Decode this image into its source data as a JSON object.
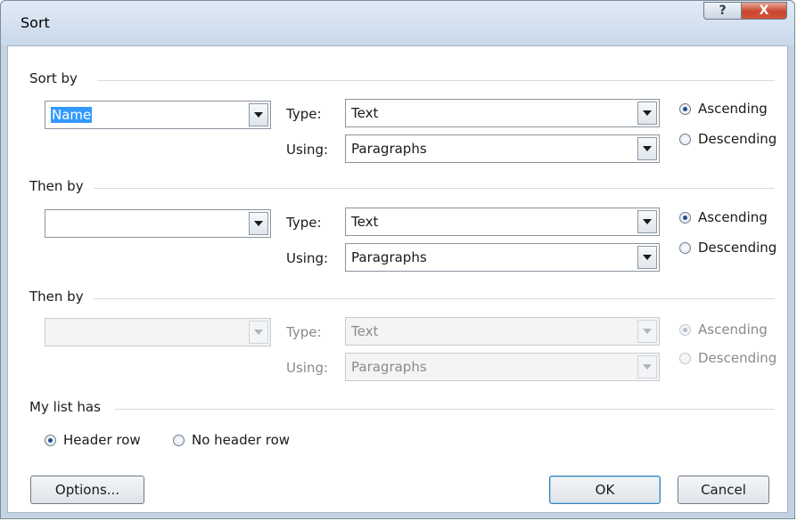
{
  "window": {
    "title": "Sort",
    "help_symbol": "?",
    "close_symbol": "X"
  },
  "sort_by": {
    "label": "Sort by",
    "field_value": "Name",
    "type_label": "Type:",
    "type_value": "Text",
    "using_label": "Using:",
    "using_value": "Paragraphs",
    "ascending_label": "Ascending",
    "descending_label": "Descending",
    "selected_order": "ascending"
  },
  "then_by_1": {
    "label": "Then by",
    "field_value": "",
    "type_label": "Type:",
    "type_value": "Text",
    "using_label": "Using:",
    "using_value": "Paragraphs",
    "ascending_label": "Ascending",
    "descending_label": "Descending",
    "selected_order": "ascending"
  },
  "then_by_2": {
    "label": "Then by",
    "field_value": "",
    "type_label": "Type:",
    "type_value": "Text",
    "using_label": "Using:",
    "using_value": "Paragraphs",
    "ascending_label": "Ascending",
    "descending_label": "Descending",
    "selected_order": "ascending",
    "disabled": true
  },
  "my_list_has": {
    "label": "My list has",
    "header_row_label": "Header row",
    "no_header_row_label": "No header row",
    "selected": "header_row"
  },
  "buttons": {
    "options": "Options...",
    "ok": "OK",
    "cancel": "Cancel"
  }
}
